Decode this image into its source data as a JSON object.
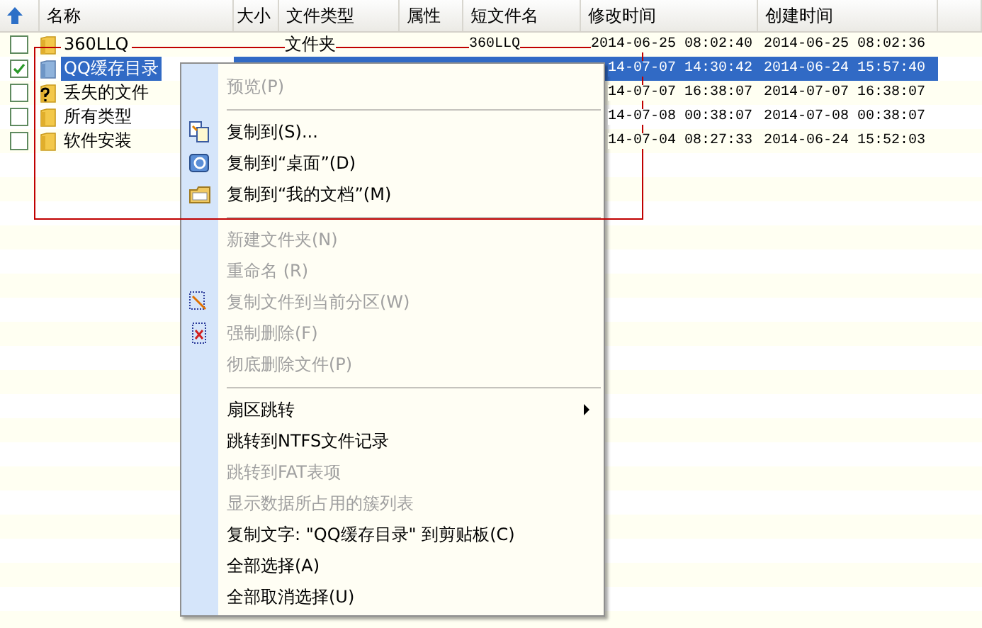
{
  "table": {
    "columns": [
      {
        "label": "名称"
      },
      {
        "label": "大小"
      },
      {
        "label": "文件类型"
      },
      {
        "label": "属性"
      },
      {
        "label": "短文件名"
      },
      {
        "label": "修改时间"
      },
      {
        "label": "创建时间"
      }
    ],
    "rows": [
      {
        "checked": false,
        "selected": false,
        "kind": "folder",
        "name": "360LLQ",
        "type": "文件夹",
        "short_name": "360LLQ",
        "modified": "2014-06-25 08:02:40",
        "created": "2014-06-25 08:02:36"
      },
      {
        "checked": true,
        "selected": true,
        "kind": "shared",
        "name": "QQ缓存目录",
        "modified": "14-07-07 14:30:42",
        "created": "2014-06-24 15:57:40"
      },
      {
        "checked": false,
        "selected": false,
        "kind": "unknown",
        "name": "丢失的文件",
        "modified": "14-07-07 16:38:07",
        "created": "2014-07-07 16:38:07"
      },
      {
        "checked": false,
        "selected": false,
        "kind": "folder",
        "name": "所有类型",
        "modified": "14-07-08 00:38:07",
        "created": "2014-07-08 00:38:07"
      },
      {
        "checked": false,
        "selected": false,
        "kind": "folder",
        "name": "软件安装",
        "modified": "14-07-04 08:27:33",
        "created": "2014-06-24 15:52:03"
      }
    ]
  },
  "annotation": {
    "kind": "frame"
  },
  "context_menu": {
    "items": [
      {
        "kind": "item",
        "label": "预览(P)",
        "disabled": true
      },
      {
        "kind": "separator"
      },
      {
        "kind": "copy",
        "label": "复制到(S)...",
        "disabled": false
      },
      {
        "kind": "desktop",
        "label": "复制到“桌面”(D)",
        "disabled": false
      },
      {
        "kind": "documents",
        "label": "复制到“我的文档”(M)",
        "disabled": false
      },
      {
        "kind": "separator"
      },
      {
        "kind": "item",
        "label": "新建文件夹(N)",
        "disabled": true
      },
      {
        "kind": "item",
        "label": "重命名 (R)",
        "disabled": true
      },
      {
        "kind": "copyhere",
        "label": "复制文件到当前分区(W)",
        "disabled": true
      },
      {
        "kind": "delete",
        "label": "强制删除(F)",
        "disabled": true
      },
      {
        "kind": "item",
        "label": "彻底删除文件(P)",
        "disabled": true
      },
      {
        "kind": "separator"
      },
      {
        "kind": "submenu",
        "label": "扇区跳转",
        "disabled": false
      },
      {
        "kind": "item",
        "label": "跳转到NTFS文件记录",
        "disabled": false
      },
      {
        "kind": "item",
        "label": "跳转到FAT表项",
        "disabled": true
      },
      {
        "kind": "item",
        "label": "显示数据所占用的簇列表",
        "disabled": true
      },
      {
        "kind": "item",
        "label": "复制文字: \"QQ缓存目录\" 到剪贴板(C)",
        "disabled": false
      },
      {
        "kind": "item",
        "label": "全部选择(A)",
        "disabled": false
      },
      {
        "kind": "item",
        "label": "全部取消选择(U)",
        "disabled": false
      }
    ]
  }
}
